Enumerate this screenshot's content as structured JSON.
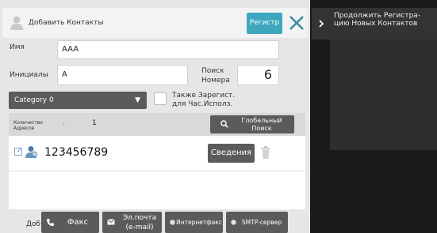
{
  "header": {
    "title": "Добавить Контакты",
    "register_label": "Регистр"
  },
  "form": {
    "name_label": "Имя",
    "name_value": "AAA",
    "initials_label": "Инициалы",
    "initials_value": "A",
    "search_number_label": [
      "Поиск",
      "Номера"
    ],
    "search_number_value": "6",
    "category_value": "Category 0",
    "also_register_label": [
      "Также Зарегист.",
      "для Час.Исполз."
    ],
    "also_register_checked": false
  },
  "address_count": {
    "label": [
      "Количество",
      "Адресов"
    ],
    "colon": ":",
    "value": "1"
  },
  "global_search": {
    "label": [
      "Глобальный",
      "Поиск"
    ]
  },
  "addresses": [
    {
      "checked": true,
      "value": "123456789",
      "details_label": "Сведения"
    }
  ],
  "bottom_bar": {
    "add_label": "Доб.",
    "fax_label": "Факс",
    "email_label": [
      "Эл.почта",
      "(e-mail)"
    ],
    "internet_fax_label": "Интернетфакс",
    "smtp_label": "SMTP-сервер"
  },
  "side_action": {
    "continue_label": [
      "Продолжить Регистра-",
      "цию Новых Контактов"
    ]
  },
  "icons": {
    "header": "person-icon",
    "close": "close-icon",
    "category_chevron": "chevron-down-icon",
    "global_search": "search-icon",
    "address_type": "person-icon",
    "trash": "trash-icon",
    "fax": "phone-icon",
    "email": "envelope-icon",
    "internet_fax": "dot-icon",
    "smtp": "dot-icon",
    "continue": "chevron-right-icon"
  },
  "colors": {
    "accent": "#3ea7be",
    "button_dark": "#5b5b5b",
    "panel_bg": "#e6e6e6",
    "side_bg": "#1a1a1a"
  }
}
